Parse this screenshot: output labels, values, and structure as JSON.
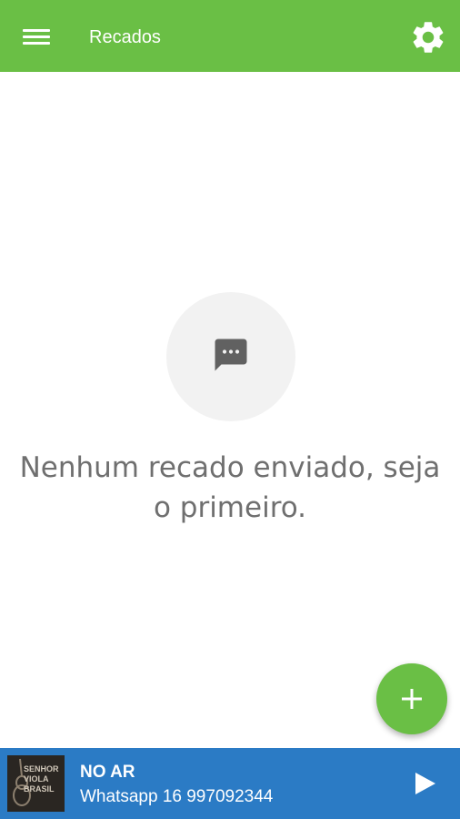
{
  "header": {
    "title": "Recados",
    "menu_icon": "hamburger-menu-icon",
    "settings_icon": "gear-icon",
    "background_color": "#6abf45"
  },
  "empty_state": {
    "icon": "chat-bubble-icon",
    "message": "Nenhum recado enviado, seja o primeiro."
  },
  "fab": {
    "icon": "plus-icon",
    "color": "#6abf45"
  },
  "player": {
    "status": "NO AR",
    "subtitle": "Whatsapp 16 997092344",
    "cover_text": "SENHOR VIOLA BRASIL",
    "play_icon": "play-icon",
    "background_color": "#2b7bc5"
  }
}
